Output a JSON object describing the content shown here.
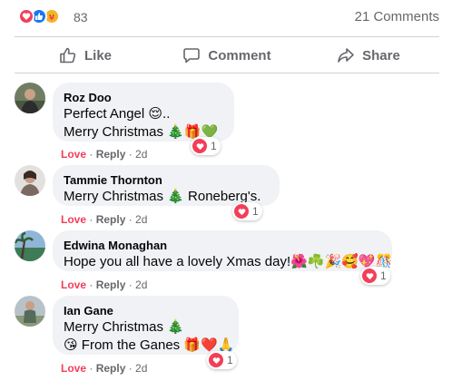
{
  "post": {
    "reaction_count": "83",
    "comments_count": "21 Comments",
    "reaction_icons": [
      "love-icon",
      "like-icon",
      "care-icon"
    ]
  },
  "actions": {
    "like": "Like",
    "comment": "Comment",
    "share": "Share"
  },
  "colors": {
    "love": "#f33e58",
    "like": "#1877f2",
    "muted": "#65676b",
    "bubble": "#f0f2f5"
  },
  "comments": [
    {
      "author": "Roz Doo",
      "lines": [
        "Perfect Angel 😌..",
        "Merry Christmas 🎄🎁💚"
      ],
      "meta": {
        "love": "Love",
        "reply": "Reply",
        "time": "2d"
      },
      "reactions": "1"
    },
    {
      "author": "Tammie Thornton",
      "lines": [
        "Merry Christmas 🎄 Roneberg's."
      ],
      "meta": {
        "love": "Love",
        "reply": "Reply",
        "time": "2d"
      },
      "reactions": "1"
    },
    {
      "author": "Edwina Monaghan",
      "lines": [
        "Hope you all have a lovely Xmas day!🌺☘️🎉🥰💖🎊"
      ],
      "meta": {
        "love": "Love",
        "reply": "Reply",
        "time": "2d"
      },
      "reactions": "1"
    },
    {
      "author": "Ian Gane",
      "lines": [
        "Merry Christmas 🎄",
        "😘 From the Ganes 🎁❤️🙏"
      ],
      "meta": {
        "love": "Love",
        "reply": "Reply",
        "time": "2d"
      },
      "reactions": "1"
    }
  ]
}
